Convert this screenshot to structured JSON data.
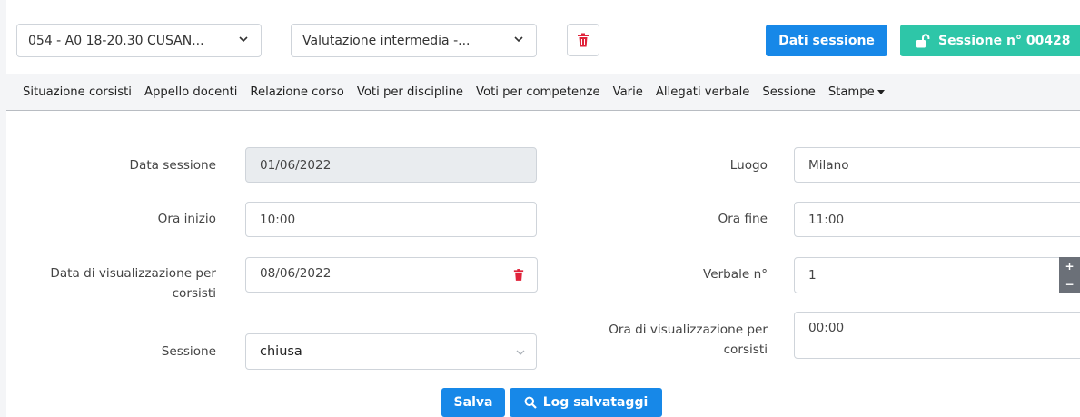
{
  "toolbar": {
    "course_select": "054 - A0 18-20.30 CUSAN...",
    "type_select": "Valutazione intermedia -...",
    "delete_icon": "trash-icon",
    "session_data_button": "Dati sessione",
    "session_number_button": "Sessione n° 00428",
    "session_number_icon": "unlock-icon"
  },
  "menu": {
    "items": [
      "Situazione corsisti",
      "Appello docenti",
      "Relazione corso",
      "Voti per discipline",
      "Voti per competenze",
      "Varie",
      "Allegati verbale",
      "Sessione",
      "Stampe"
    ]
  },
  "form": {
    "data_sessione_label": "Data sessione",
    "data_sessione_value": "01/06/2022",
    "ora_inizio_label": "Ora inizio",
    "ora_inizio_value": "10:00",
    "data_visualizzazione_label_1": "Data di visualizzazione per",
    "data_visualizzazione_label_2": "corsisti",
    "data_visualizzazione_value": "08/06/2022",
    "sessione_label": "Sessione",
    "sessione_value": "chiusa",
    "luogo_label": "Luogo",
    "luogo_value": "Milano",
    "ora_fine_label": "Ora fine",
    "ora_fine_value": "11:00",
    "verbale_label": "Verbale n°",
    "verbale_value": "1",
    "ora_visualizzazione_label_1": "Ora di visualizzazione per",
    "ora_visualizzazione_label_2": "corsisti",
    "ora_visualizzazione_value": "00:00"
  },
  "actions": {
    "save_label": "Salva",
    "log_label": "Log salvataggi"
  },
  "colors": {
    "primary": "#1788e8",
    "teal": "#2ec6a8",
    "danger": "#e0223a"
  }
}
